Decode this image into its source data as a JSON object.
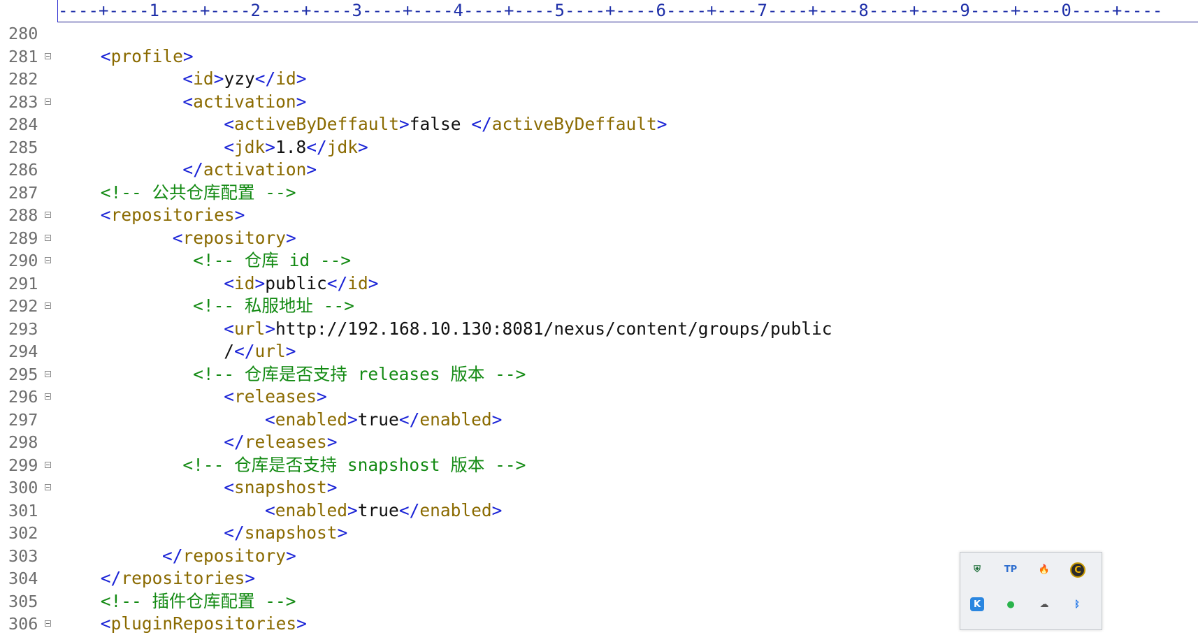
{
  "ruler": {
    "text": "----+----1----+----2----+----3----+----4----+----5----+----6----+----7----+----8----+----9----+----0----+----"
  },
  "editor": {
    "lines": [
      {
        "n": "280",
        "fold": false,
        "indent": 0,
        "tokens": []
      },
      {
        "n": "281",
        "fold": true,
        "indent": 4,
        "tokens": [
          [
            "br",
            "<"
          ],
          [
            "tg",
            "profile"
          ],
          [
            "br",
            ">"
          ]
        ]
      },
      {
        "n": "282",
        "fold": false,
        "indent": 12,
        "tokens": [
          [
            "br",
            "<"
          ],
          [
            "tg",
            "id"
          ],
          [
            "br",
            ">"
          ],
          [
            "tx",
            "yzy"
          ],
          [
            "br",
            "</"
          ],
          [
            "tg",
            "id"
          ],
          [
            "br",
            ">"
          ]
        ]
      },
      {
        "n": "283",
        "fold": true,
        "indent": 12,
        "tokens": [
          [
            "br",
            "<"
          ],
          [
            "tg",
            "activation"
          ],
          [
            "br",
            ">"
          ]
        ]
      },
      {
        "n": "284",
        "fold": false,
        "indent": 16,
        "tokens": [
          [
            "br",
            "<"
          ],
          [
            "tg",
            "activeByDeffault"
          ],
          [
            "br",
            ">"
          ],
          [
            "tx",
            "false "
          ],
          [
            "br",
            "</"
          ],
          [
            "tg",
            "activeByDeffault"
          ],
          [
            "br",
            ">"
          ]
        ]
      },
      {
        "n": "285",
        "fold": false,
        "indent": 16,
        "tokens": [
          [
            "br",
            "<"
          ],
          [
            "tg",
            "jdk"
          ],
          [
            "br",
            ">"
          ],
          [
            "tx",
            "1.8"
          ],
          [
            "br",
            "</"
          ],
          [
            "tg",
            "jdk"
          ],
          [
            "br",
            ">"
          ]
        ]
      },
      {
        "n": "286",
        "fold": false,
        "indent": 12,
        "tokens": [
          [
            "br",
            "</"
          ],
          [
            "tg",
            "activation"
          ],
          [
            "br",
            ">"
          ]
        ]
      },
      {
        "n": "287",
        "fold": false,
        "indent": 4,
        "tokens": [
          [
            "cm",
            "<!-- 公共仓库配置 -->"
          ]
        ]
      },
      {
        "n": "288",
        "fold": true,
        "indent": 4,
        "tokens": [
          [
            "br",
            "<"
          ],
          [
            "tg",
            "repositories"
          ],
          [
            "br",
            ">"
          ]
        ]
      },
      {
        "n": "289",
        "fold": true,
        "indent": 11,
        "tokens": [
          [
            "br",
            "<"
          ],
          [
            "tg",
            "repository"
          ],
          [
            "br",
            ">"
          ]
        ]
      },
      {
        "n": "290",
        "fold": true,
        "indent": 13,
        "tokens": [
          [
            "cm",
            "<!-- 仓库 id -->"
          ]
        ]
      },
      {
        "n": "291",
        "fold": false,
        "indent": 16,
        "tokens": [
          [
            "br",
            "<"
          ],
          [
            "tg",
            "id"
          ],
          [
            "br",
            ">"
          ],
          [
            "tx",
            "public"
          ],
          [
            "br",
            "</"
          ],
          [
            "tg",
            "id"
          ],
          [
            "br",
            ">"
          ]
        ]
      },
      {
        "n": "292",
        "fold": true,
        "indent": 13,
        "tokens": [
          [
            "cm",
            "<!-- 私服地址 -->"
          ]
        ]
      },
      {
        "n": "293",
        "fold": false,
        "indent": 16,
        "tokens": [
          [
            "br",
            "<"
          ],
          [
            "tg",
            "url"
          ],
          [
            "br",
            ">"
          ],
          [
            "tx",
            "http://192.168.10.130:8081/nexus/content/groups/public"
          ]
        ]
      },
      {
        "n": "294",
        "fold": false,
        "indent": 16,
        "tokens": [
          [
            "tx",
            "/"
          ],
          [
            "br",
            "</"
          ],
          [
            "tg",
            "url"
          ],
          [
            "br",
            ">"
          ]
        ]
      },
      {
        "n": "295",
        "fold": true,
        "indent": 13,
        "tokens": [
          [
            "cm",
            "<!-- 仓库是否支持 releases 版本 -->"
          ]
        ]
      },
      {
        "n": "296",
        "fold": true,
        "indent": 16,
        "tokens": [
          [
            "br",
            "<"
          ],
          [
            "tg",
            "releases"
          ],
          [
            "br",
            ">"
          ]
        ]
      },
      {
        "n": "297",
        "fold": false,
        "indent": 20,
        "tokens": [
          [
            "br",
            "<"
          ],
          [
            "tg",
            "enabled"
          ],
          [
            "br",
            ">"
          ],
          [
            "tx",
            "true"
          ],
          [
            "br",
            "</"
          ],
          [
            "tg",
            "enabled"
          ],
          [
            "br",
            ">"
          ]
        ]
      },
      {
        "n": "298",
        "fold": false,
        "indent": 16,
        "tokens": [
          [
            "br",
            "</"
          ],
          [
            "tg",
            "releases"
          ],
          [
            "br",
            ">"
          ]
        ]
      },
      {
        "n": "299",
        "fold": true,
        "indent": 12,
        "tokens": [
          [
            "cm",
            "<!-- 仓库是否支持 snapshost 版本 -->"
          ]
        ]
      },
      {
        "n": "300",
        "fold": true,
        "indent": 16,
        "tokens": [
          [
            "br",
            "<"
          ],
          [
            "tg",
            "snapshost"
          ],
          [
            "br",
            ">"
          ]
        ]
      },
      {
        "n": "301",
        "fold": false,
        "indent": 20,
        "tokens": [
          [
            "br",
            "<"
          ],
          [
            "tg",
            "enabled"
          ],
          [
            "br",
            ">"
          ],
          [
            "tx",
            "true"
          ],
          [
            "br",
            "</"
          ],
          [
            "tg",
            "enabled"
          ],
          [
            "br",
            ">"
          ]
        ]
      },
      {
        "n": "302",
        "fold": false,
        "indent": 16,
        "tokens": [
          [
            "br",
            "</"
          ],
          [
            "tg",
            "snapshost"
          ],
          [
            "br",
            ">"
          ]
        ]
      },
      {
        "n": "303",
        "fold": false,
        "indent": 10,
        "tokens": [
          [
            "br",
            "</"
          ],
          [
            "tg",
            "repository"
          ],
          [
            "br",
            ">"
          ]
        ]
      },
      {
        "n": "304",
        "fold": false,
        "indent": 4,
        "tokens": [
          [
            "br",
            "</"
          ],
          [
            "tg",
            "repositories"
          ],
          [
            "br",
            ">"
          ]
        ]
      },
      {
        "n": "305",
        "fold": false,
        "indent": 4,
        "tokens": [
          [
            "cm",
            "<!-- 插件仓库配置 -->"
          ]
        ]
      },
      {
        "n": "306",
        "fold": true,
        "indent": 4,
        "tokens": [
          [
            "br",
            "<"
          ],
          [
            "tg",
            "pluginRepositories"
          ],
          [
            "br",
            ">"
          ]
        ]
      }
    ]
  },
  "tray": {
    "icons": [
      {
        "name": "security-shield-icon",
        "glyph": "⛨",
        "color": "#1f6f3a"
      },
      {
        "name": "tp-app-icon",
        "glyph": "TP",
        "color": "#2f6fcf"
      },
      {
        "name": "flame-app-icon",
        "glyph": "🔥",
        "color": "#f0a020"
      },
      {
        "name": "c-app-icon",
        "glyph": "C",
        "color": "#c99a00"
      },
      {
        "name": "k-app-icon",
        "glyph": "K",
        "color": "#2a86e0"
      },
      {
        "name": "wechat-icon",
        "glyph": "●",
        "color": "#2ab34b"
      },
      {
        "name": "cloud-error-icon",
        "glyph": "☁",
        "color": "#555555"
      },
      {
        "name": "bluetooth-icon",
        "glyph": "ᛒ",
        "color": "#1a73e8"
      }
    ]
  }
}
